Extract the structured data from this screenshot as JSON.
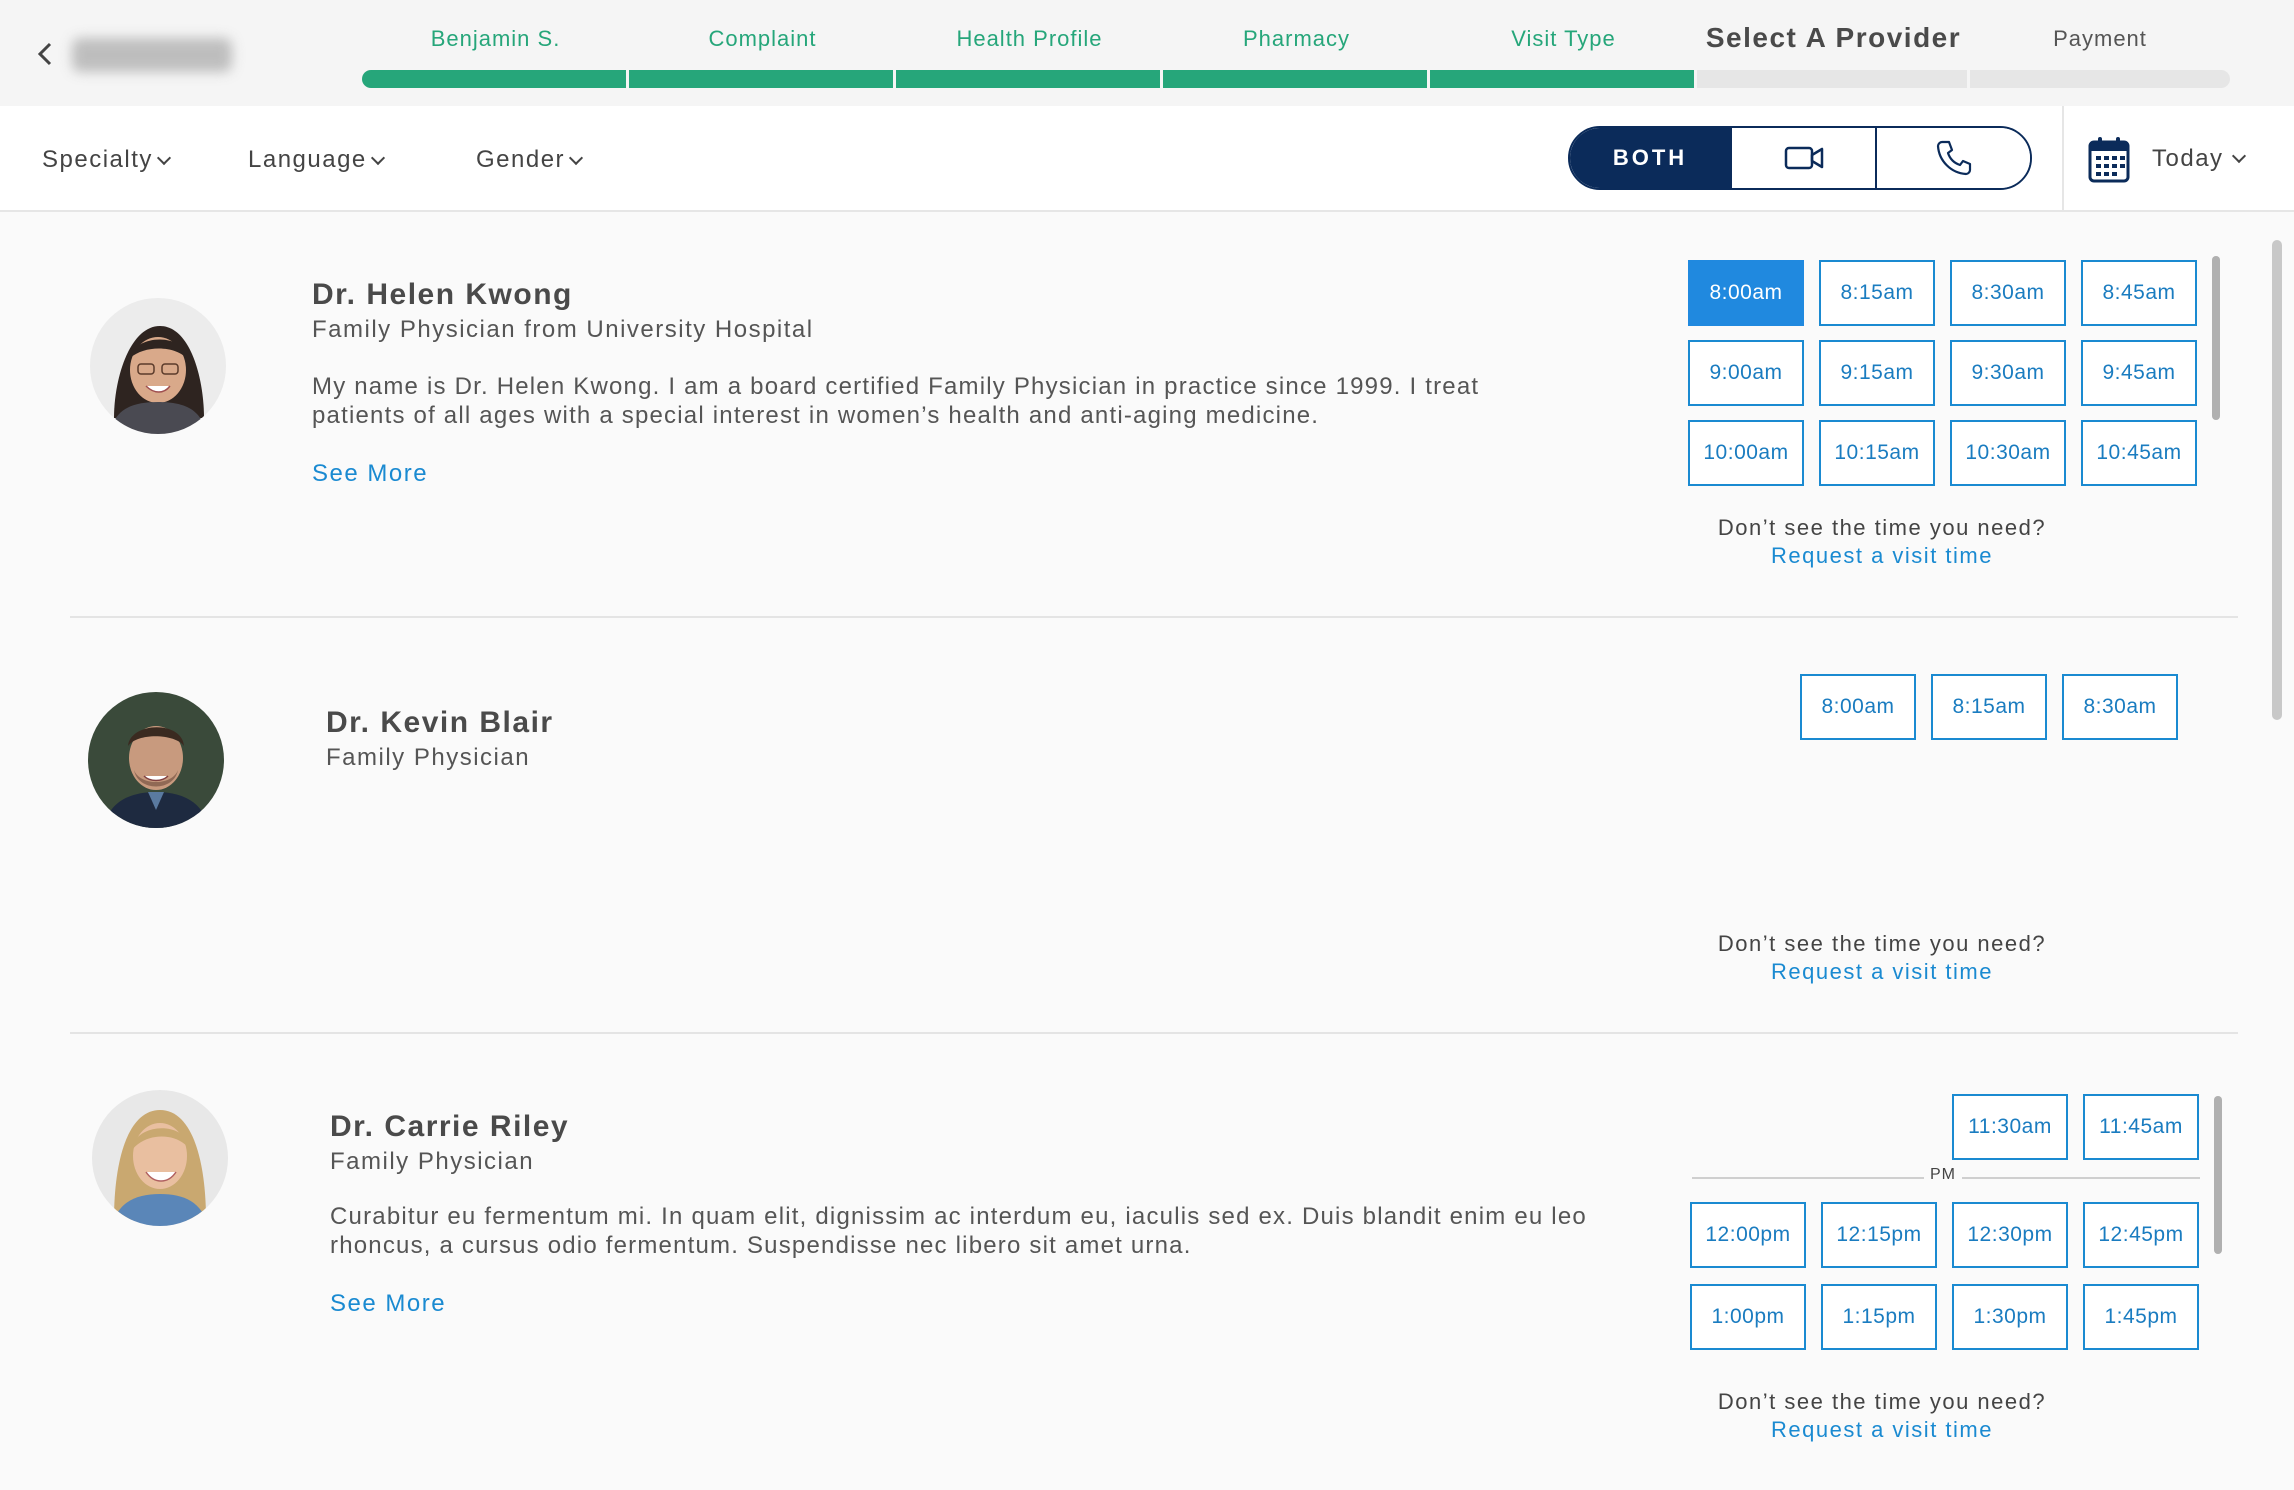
{
  "header": {
    "steps": [
      {
        "label": "Benjamin S.",
        "state": "done"
      },
      {
        "label": "Complaint",
        "state": "done"
      },
      {
        "label": "Health Profile",
        "state": "done"
      },
      {
        "label": "Pharmacy",
        "state": "done"
      },
      {
        "label": "Visit Type",
        "state": "done"
      },
      {
        "label": "Select A Provider",
        "state": "current"
      },
      {
        "label": "Payment",
        "state": "future"
      }
    ]
  },
  "filters": {
    "specialty": "Specialty",
    "language": "Language",
    "gender": "Gender"
  },
  "visit_toggle": {
    "both": "BOTH",
    "selected": "both"
  },
  "date_selector": {
    "label": "Today"
  },
  "providers": [
    {
      "name": "Dr. Helen Kwong",
      "subtitle": "Family Physician from University Hospital",
      "bio": "My name is Dr. Helen Kwong. I am a board certified Family Physician in practice since 1999. I treat patients of all ages with a special interest in women’s health and anti-aging medicine.",
      "see_more": "See More",
      "slots": [
        "8:00am",
        "8:15am",
        "8:30am",
        "8:45am",
        "9:00am",
        "9:15am",
        "9:30am",
        "9:45am",
        "10:00am",
        "10:15am",
        "10:30am",
        "10:45am"
      ],
      "selected_slot": "8:00am",
      "request_q": "Don’t see the time you need?",
      "request_link": "Request a visit time"
    },
    {
      "name": "Dr. Kevin Blair",
      "subtitle": "Family Physician",
      "slots": [
        "8:00am",
        "8:15am",
        "8:30am"
      ],
      "request_q": "Don’t see the time you need?",
      "request_link": "Request a visit time"
    },
    {
      "name": "Dr. Carrie Riley",
      "subtitle": "Family Physician",
      "bio": "Curabitur eu fermentum mi. In quam elit, dignissim ac interdum eu, iaculis sed ex. Duis blandit enim eu leo rhoncus, a cursus odio fermentum. Suspendisse nec libero sit amet urna.",
      "see_more": "See More",
      "am_slots": [
        "11:30am",
        "11:45am"
      ],
      "pm_label": "PM",
      "pm_slots": [
        "12:00pm",
        "12:15pm",
        "12:30pm",
        "12:45pm",
        "1:00pm",
        "1:15pm",
        "1:30pm",
        "1:45pm"
      ],
      "request_q": "Don’t see the time you need?",
      "request_link": "Request a visit time"
    }
  ],
  "colors": {
    "progress_green": "#26a67a",
    "navy": "#0b2b5a",
    "link_blue": "#1a8ad1",
    "selected_slot": "#2089df"
  }
}
